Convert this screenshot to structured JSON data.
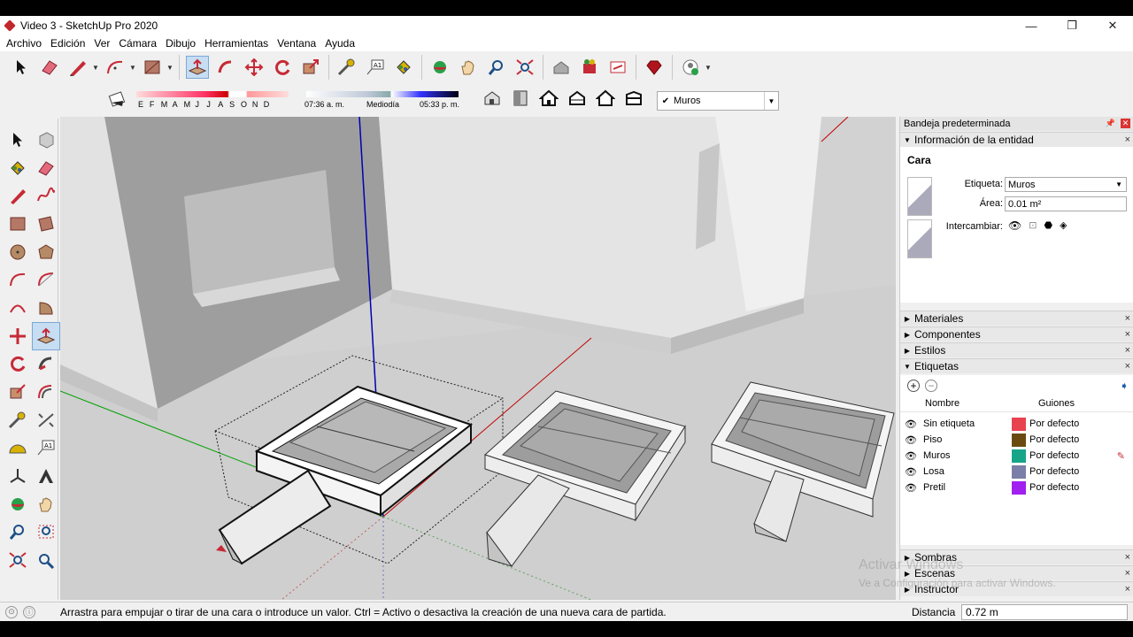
{
  "window": {
    "title": "Video 3 - SketchUp Pro 2020",
    "controls": [
      "—",
      "❐",
      "✕"
    ]
  },
  "menu": [
    "Archivo",
    "Edición",
    "Ver",
    "Cámara",
    "Dibujo",
    "Herramientas",
    "Ventana",
    "Ayuda"
  ],
  "shadow": {
    "months": [
      "E",
      "F",
      "M",
      "A",
      "M",
      "J",
      "J",
      "A",
      "S",
      "O",
      "N",
      "D"
    ],
    "time_start": "07:36 a. m.",
    "time_mid": "Mediodía",
    "time_end": "05:33 p. m."
  },
  "toolbar": {
    "active_tag": "Muros"
  },
  "panel": {
    "title": "Bandeja predeterminada",
    "entity_info": {
      "header": "Información de la entidad",
      "type": "Cara",
      "tag_label": "Etiqueta:",
      "tag_value": "Muros",
      "area_label": "Área:",
      "area_value": "0.01 m²",
      "toggle_label": "Intercambiar:"
    },
    "sections": [
      "Materiales",
      "Componentes",
      "Estilos",
      "Etiquetas"
    ],
    "tags": {
      "col_name": "Nombre",
      "col_dash": "Guiones",
      "rows": [
        {
          "name": "Sin etiqueta",
          "dash": "Por defecto",
          "color": "#e8424f"
        },
        {
          "name": "Piso",
          "dash": "Por defecto",
          "color": "#6b4a12"
        },
        {
          "name": "Muros",
          "dash": "Por defecto",
          "color": "#17a589"
        },
        {
          "name": "Losa",
          "dash": "Por defecto",
          "color": "#7a7fa8"
        },
        {
          "name": "Pretil",
          "dash": "Por defecto",
          "color": "#a020f0"
        }
      ]
    },
    "bottom_sections": [
      "Sombras",
      "Escenas",
      "Instructor"
    ]
  },
  "status": {
    "message": "Arrastra para empujar o tirar de una cara o introduce un valor. Ctrl = Activo o desactiva la creación de una nueva cara de partida.",
    "distance_label": "Distancia",
    "distance_value": "0.72 m"
  },
  "watermark": {
    "line1": "Activar Windows",
    "line2": "Ve a Configuración para activar Windows."
  }
}
